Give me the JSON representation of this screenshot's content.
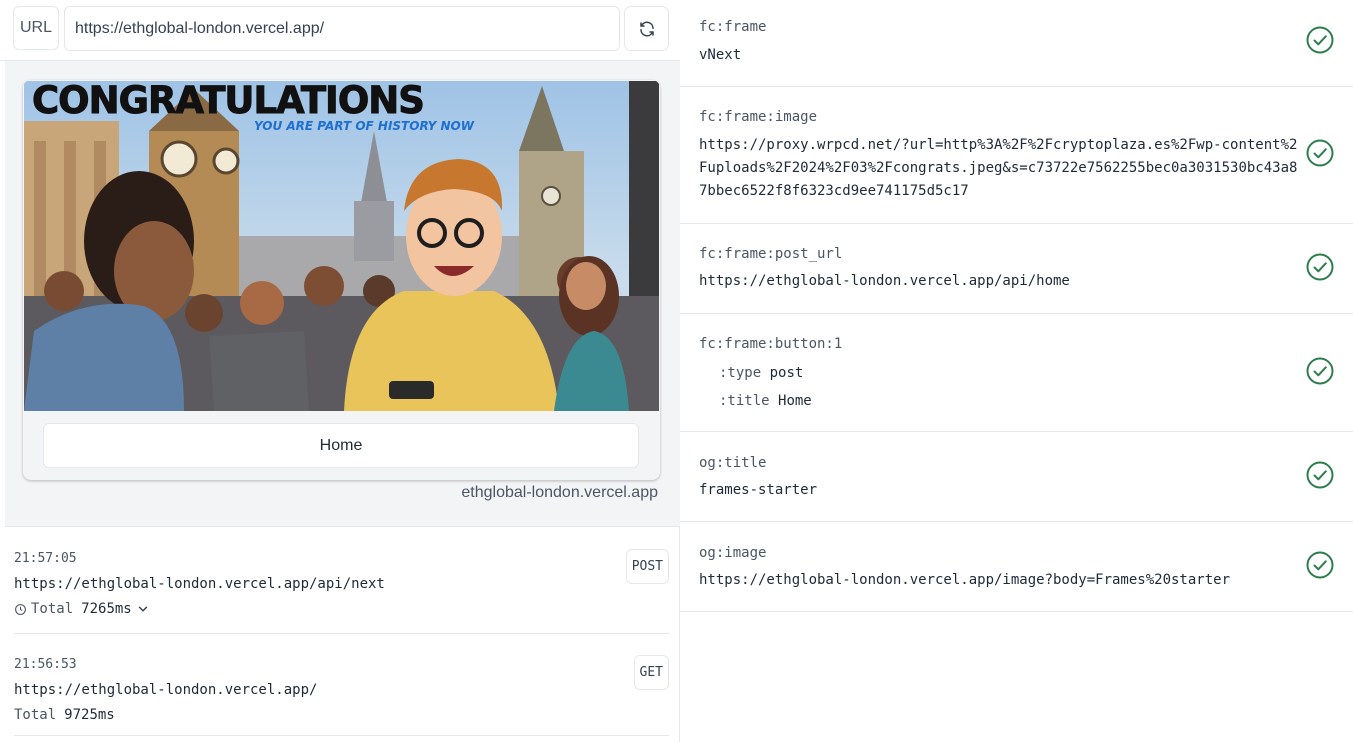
{
  "url_bar": {
    "label": "URL",
    "value": "https://ethglobal-london.vercel.app/"
  },
  "frame_preview": {
    "image_heading": "CONGRATULATIONS",
    "image_subheading": "YOU ARE PART OF HISTORY NOW",
    "button_label": "Home",
    "domain": "ethglobal-london.vercel.app"
  },
  "request_log": [
    {
      "time": "21:57:05",
      "url": "https://ethglobal-london.vercel.app/api/next",
      "total_label": "Total",
      "duration": "7265ms",
      "method": "POST"
    },
    {
      "time": "21:56:53",
      "url": "https://ethglobal-london.vercel.app/",
      "total_label": "Total",
      "duration": "9725ms",
      "method": "GET"
    }
  ],
  "meta_tags": [
    {
      "key": "fc:frame",
      "value": "vNext",
      "valid": true
    },
    {
      "key": "fc:frame:image",
      "value": "https://proxy.wrpcd.net/?url=http%3A%2F%2Fcryptoplaza.es%2Fwp-content%2Fuploads%2F2024%2F03%2Fcongrats.jpeg&s=c73722e7562255bec0a3031530bc43a87bbec6522f8f6323cd9ee741175d5c17",
      "valid": true
    },
    {
      "key": "fc:frame:post_url",
      "value": "https://ethglobal-london.vercel.app/api/home",
      "valid": true
    },
    {
      "key": "fc:frame:button:1",
      "type_label": ":type",
      "type_value": "post",
      "title_label": ":title",
      "title_value": "Home",
      "valid": true
    },
    {
      "key": "og:title",
      "value": "frames-starter",
      "valid": true
    },
    {
      "key": "og:image",
      "value": "https://ethglobal-london.vercel.app/image?body=Frames%20starter",
      "valid": true
    }
  ],
  "colors": {
    "check_green": "#2e7d4f",
    "panel_bg": "#f3f4f6",
    "border": "#e5e7eb"
  }
}
